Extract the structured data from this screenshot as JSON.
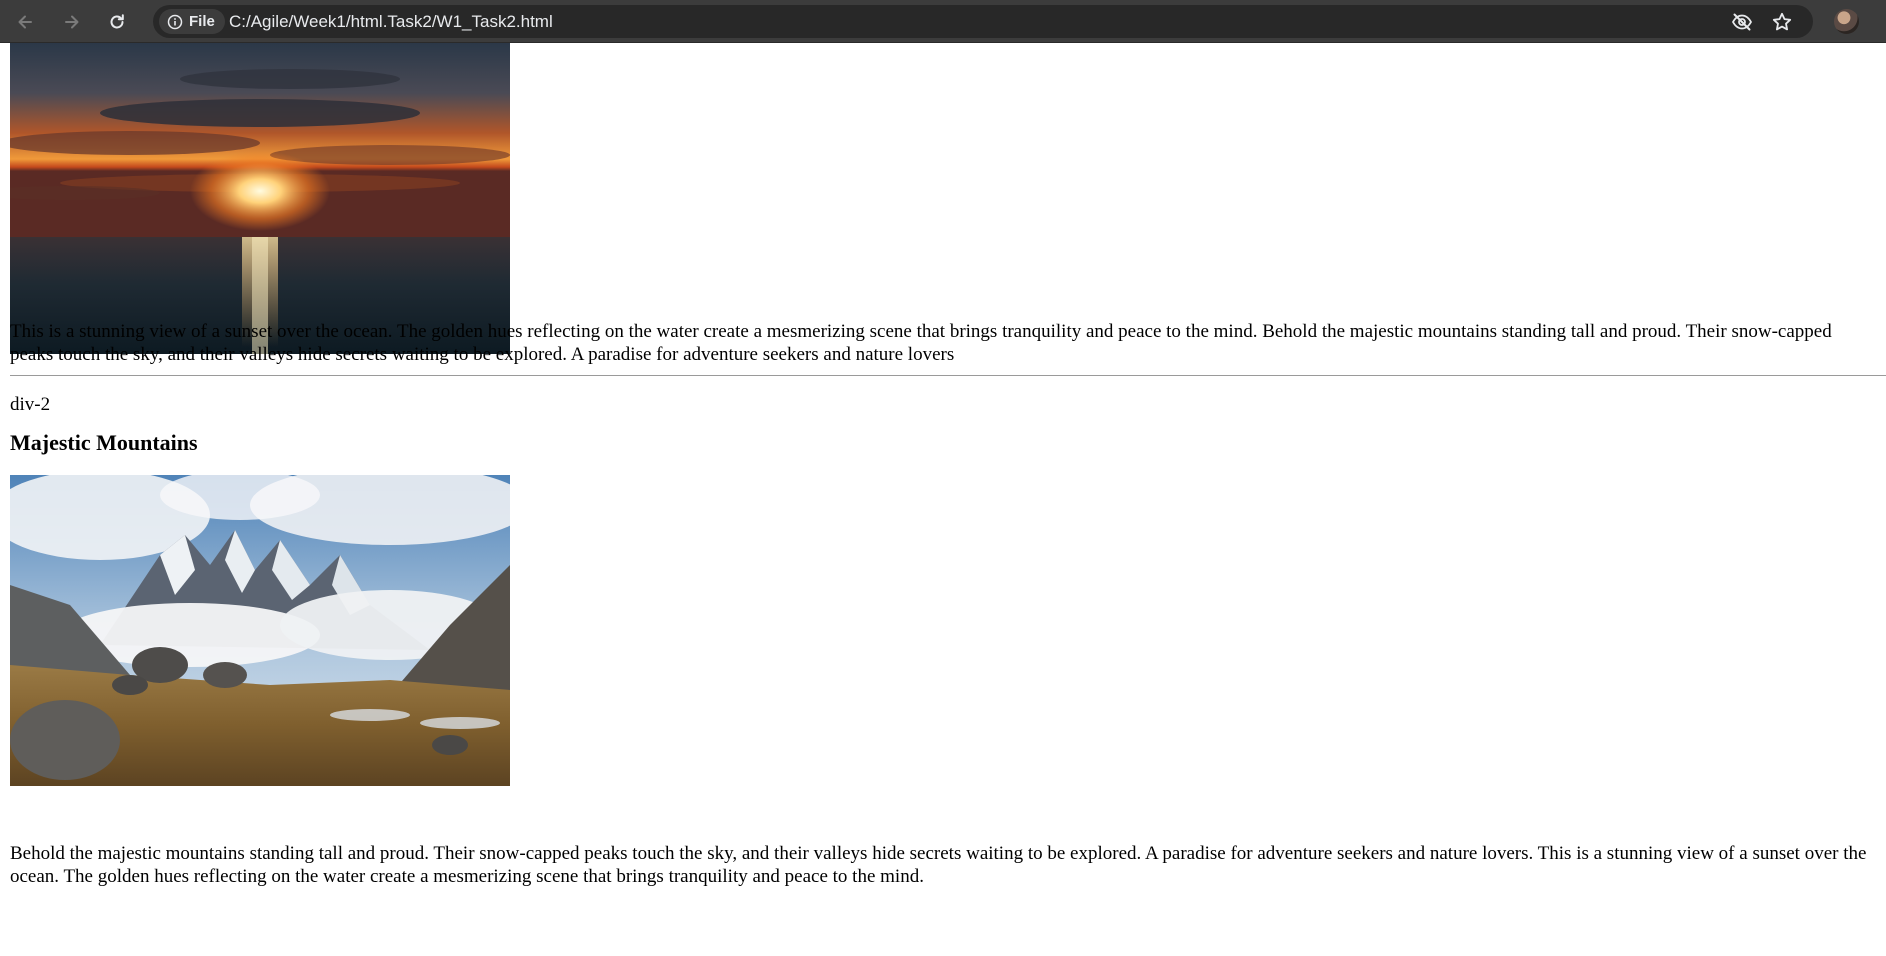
{
  "browser": {
    "chip_label": "File",
    "url": "C:/Agile/Week1/html.Task2/W1_Task2.html",
    "icons": [
      "back-arrow-icon",
      "forward-arrow-icon",
      "reload-icon",
      "info-icon",
      "eye-slash-icon",
      "star-icon",
      "profile-avatar"
    ]
  },
  "section1": {
    "image_alt": "Sunset over the ocean",
    "paragraph": "This is a stunning view of a sunset over the ocean. The golden hues reflecting on the water create a mesmerizing scene that brings tranquility and peace to the mind. Behold the majestic mountains standing tall and proud. Their snow-capped peaks touch the sky, and their valleys hide secrets waiting to be explored. A paradise for adventure seekers and nature lovers"
  },
  "section2": {
    "label": "div-2",
    "heading": "Majestic Mountains",
    "image_alt": "Snow-capped mountain peaks above a valley",
    "paragraph": "Behold the majestic mountains standing tall and proud. Their snow-capped peaks touch the sky, and their valleys hide secrets waiting to be explored. A paradise for adventure seekers and nature lovers. This is a stunning view of a sunset over the ocean. The golden hues reflecting on the water create a mesmerizing scene that brings tranquility and peace to the mind."
  },
  "colors": {
    "toolbar": "#3c3c3c",
    "omnibox": "#282828",
    "divider": "#9a9a9a"
  }
}
